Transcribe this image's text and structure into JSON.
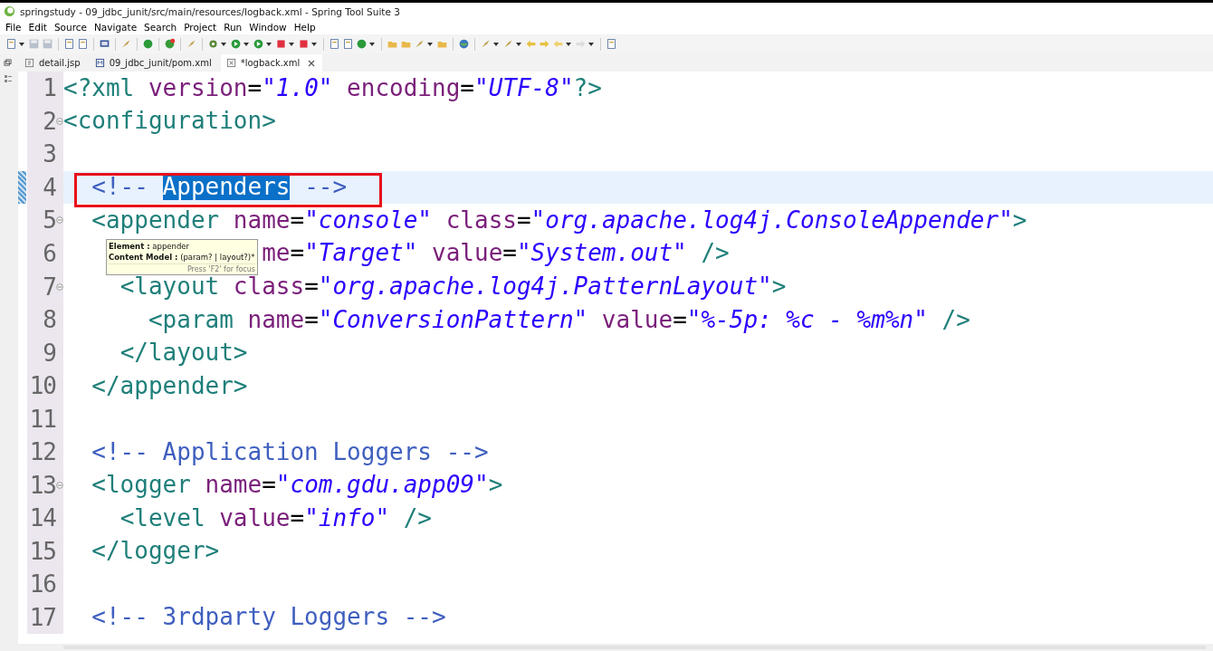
{
  "window": {
    "title": "springstudy - 09_jdbc_junit/src/main/resources/logback.xml - Spring Tool Suite 3"
  },
  "menu": [
    "File",
    "Edit",
    "Source",
    "Navigate",
    "Search",
    "Project",
    "Run",
    "Window",
    "Help"
  ],
  "tabs": [
    {
      "label": "detail.jsp",
      "kind": "jsp",
      "selected": false,
      "dirty_close": false
    },
    {
      "label": "09_jdbc_junit/pom.xml",
      "kind": "maven",
      "selected": false,
      "dirty_close": false
    },
    {
      "label": "*logback.xml",
      "kind": "xml",
      "selected": true,
      "dirty_close": true
    }
  ],
  "editor": {
    "lines": [
      {
        "number": "1",
        "fold": false,
        "current": false,
        "marked": false,
        "tokens": [
          {
            "kind": "tag",
            "text": "<?xml"
          },
          {
            "kind": "attr",
            "text": " version"
          },
          {
            "kind": "eq",
            "text": "="
          },
          {
            "kind": "str",
            "text": "\"1.0\""
          },
          {
            "kind": "attr",
            "text": " encoding"
          },
          {
            "kind": "eq",
            "text": "="
          },
          {
            "kind": "str",
            "text": "\"UTF-8\""
          },
          {
            "kind": "tag",
            "text": "?>"
          }
        ]
      },
      {
        "number": "2",
        "fold": true,
        "current": false,
        "marked": false,
        "tokens": [
          {
            "kind": "tag",
            "text": "<configuration>"
          }
        ]
      },
      {
        "number": "3",
        "fold": false,
        "current": false,
        "marked": false
      },
      {
        "number": "4",
        "fold": false,
        "current": true,
        "marked": true,
        "tokens": [
          {
            "kind": "comment",
            "text": "  <!-- "
          },
          {
            "kind": "selection",
            "text": "Appenders"
          },
          {
            "kind": "comment",
            "text": " -->"
          }
        ]
      },
      {
        "number": "5",
        "fold": true,
        "current": false,
        "marked": false,
        "tokens": [
          {
            "kind": "tag",
            "text": "  <appender"
          },
          {
            "kind": "attr",
            "text": " name"
          },
          {
            "kind": "eq",
            "text": "="
          },
          {
            "kind": "str",
            "text": "\"console\""
          },
          {
            "kind": "attr",
            "text": " class"
          },
          {
            "kind": "eq",
            "text": "="
          },
          {
            "kind": "str",
            "text": "\"org.apache.log4j.ConsoleAppender\""
          },
          {
            "kind": "tag",
            "text": ">"
          }
        ]
      },
      {
        "number": "6",
        "fold": false,
        "current": false,
        "marked": false,
        "tokens": [
          {
            "kind": "attr",
            "text": "              me"
          },
          {
            "kind": "eq",
            "text": "="
          },
          {
            "kind": "str",
            "text": "\"Target\""
          },
          {
            "kind": "attr",
            "text": " value"
          },
          {
            "kind": "eq",
            "text": "="
          },
          {
            "kind": "str",
            "text": "\"System.out\""
          },
          {
            "kind": "tag",
            "text": " />"
          }
        ]
      },
      {
        "number": "7",
        "fold": true,
        "current": false,
        "marked": false,
        "tokens": [
          {
            "kind": "tag",
            "text": "    <layout"
          },
          {
            "kind": "attr",
            "text": " class"
          },
          {
            "kind": "eq",
            "text": "="
          },
          {
            "kind": "str",
            "text": "\"org.apache.log4j.PatternLayout\""
          },
          {
            "kind": "tag",
            "text": ">"
          }
        ]
      },
      {
        "number": "8",
        "fold": false,
        "current": false,
        "marked": false,
        "tokens": [
          {
            "kind": "tag",
            "text": "      <param"
          },
          {
            "kind": "attr",
            "text": " name"
          },
          {
            "kind": "eq",
            "text": "="
          },
          {
            "kind": "str",
            "text": "\"ConversionPattern\""
          },
          {
            "kind": "attr",
            "text": " value"
          },
          {
            "kind": "eq",
            "text": "="
          },
          {
            "kind": "str",
            "text": "\"%-5p: %c - %m%n\""
          },
          {
            "kind": "tag",
            "text": " />"
          }
        ]
      },
      {
        "number": "9",
        "fold": false,
        "current": false,
        "marked": false,
        "tokens": [
          {
            "kind": "tag",
            "text": "    </layout>"
          }
        ]
      },
      {
        "number": "10",
        "fold": false,
        "current": false,
        "marked": false,
        "tokens": [
          {
            "kind": "tag",
            "text": "  </appender>"
          }
        ]
      },
      {
        "number": "11",
        "fold": false,
        "current": false,
        "marked": false
      },
      {
        "number": "12",
        "fold": false,
        "current": false,
        "marked": false,
        "tokens": [
          {
            "kind": "comment",
            "text": "  <!-- Application Loggers -->"
          }
        ]
      },
      {
        "number": "13",
        "fold": true,
        "current": false,
        "marked": false,
        "tokens": [
          {
            "kind": "tag",
            "text": "  <logger"
          },
          {
            "kind": "attr",
            "text": " name"
          },
          {
            "kind": "eq",
            "text": "="
          },
          {
            "kind": "str",
            "text": "\"com.gdu.app09\""
          },
          {
            "kind": "tag",
            "text": ">"
          }
        ]
      },
      {
        "number": "14",
        "fold": false,
        "current": false,
        "marked": false,
        "tokens": [
          {
            "kind": "tag",
            "text": "    <level"
          },
          {
            "kind": "attr",
            "text": " value"
          },
          {
            "kind": "eq",
            "text": "="
          },
          {
            "kind": "str",
            "text": "\"info\""
          },
          {
            "kind": "tag",
            "text": " />"
          }
        ]
      },
      {
        "number": "15",
        "fold": false,
        "current": false,
        "marked": false,
        "tokens": [
          {
            "kind": "tag",
            "text": "  </logger>"
          }
        ]
      },
      {
        "number": "16",
        "fold": false,
        "current": false,
        "marked": false
      },
      {
        "number": "17",
        "fold": false,
        "current": false,
        "marked": false,
        "tokens": [
          {
            "kind": "comment",
            "text": "  <!-- 3rdparty Loggers -->"
          }
        ]
      }
    ]
  },
  "tooltip": {
    "lines": [
      "**Element :** appender",
      "**Content Model :** (param? | layout?)*"
    ],
    "hint": "Press 'F2' for focus"
  }
}
